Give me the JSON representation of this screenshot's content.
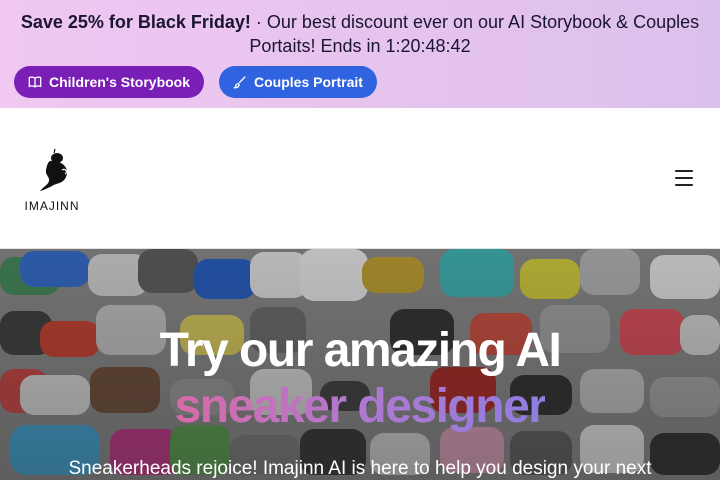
{
  "promo": {
    "headline": "Save 25% for Black Friday!",
    "separator": "·",
    "message": "Our best discount ever on our AI Storybook & Couples Portaits! Ends in",
    "countdown": "1:20:48:42",
    "buttons": [
      {
        "label": "Children's Storybook",
        "icon": "book-icon",
        "color": "#7a1fb6"
      },
      {
        "label": "Couples Portrait",
        "icon": "brush-icon",
        "color": "#2f63e0"
      }
    ]
  },
  "header": {
    "logo_text": "IMAJINN",
    "menu_icon": "hamburger-menu-icon"
  },
  "hero": {
    "title": "Try our amazing AI",
    "subtitle": "sneaker designer",
    "description": "Sneakerheads rejoice! Imajinn AI is here to help you design your next",
    "gradient_colors": [
      "#d86aa8",
      "#b078d0",
      "#8f7ee0"
    ]
  }
}
